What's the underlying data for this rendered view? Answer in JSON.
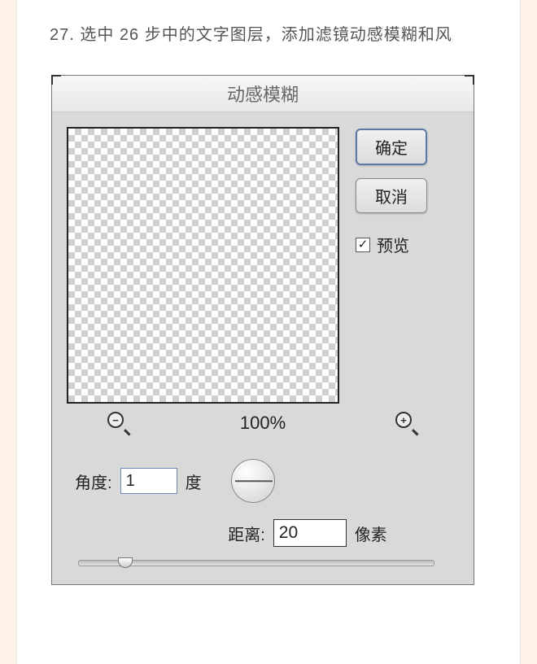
{
  "step": {
    "number": "27.",
    "text": "选中 26 步中的文字图层，添加滤镜动感模糊和风"
  },
  "dialog": {
    "title": "动感模糊",
    "buttons": {
      "ok": "确定",
      "cancel": "取消"
    },
    "preview_label": "预览",
    "zoom": {
      "out_symbol": "−",
      "level": "100%",
      "in_symbol": "+"
    },
    "angle": {
      "label": "角度:",
      "value": "1",
      "unit": "度"
    },
    "distance": {
      "label": "距离:",
      "value": "20",
      "unit": "像素"
    }
  }
}
